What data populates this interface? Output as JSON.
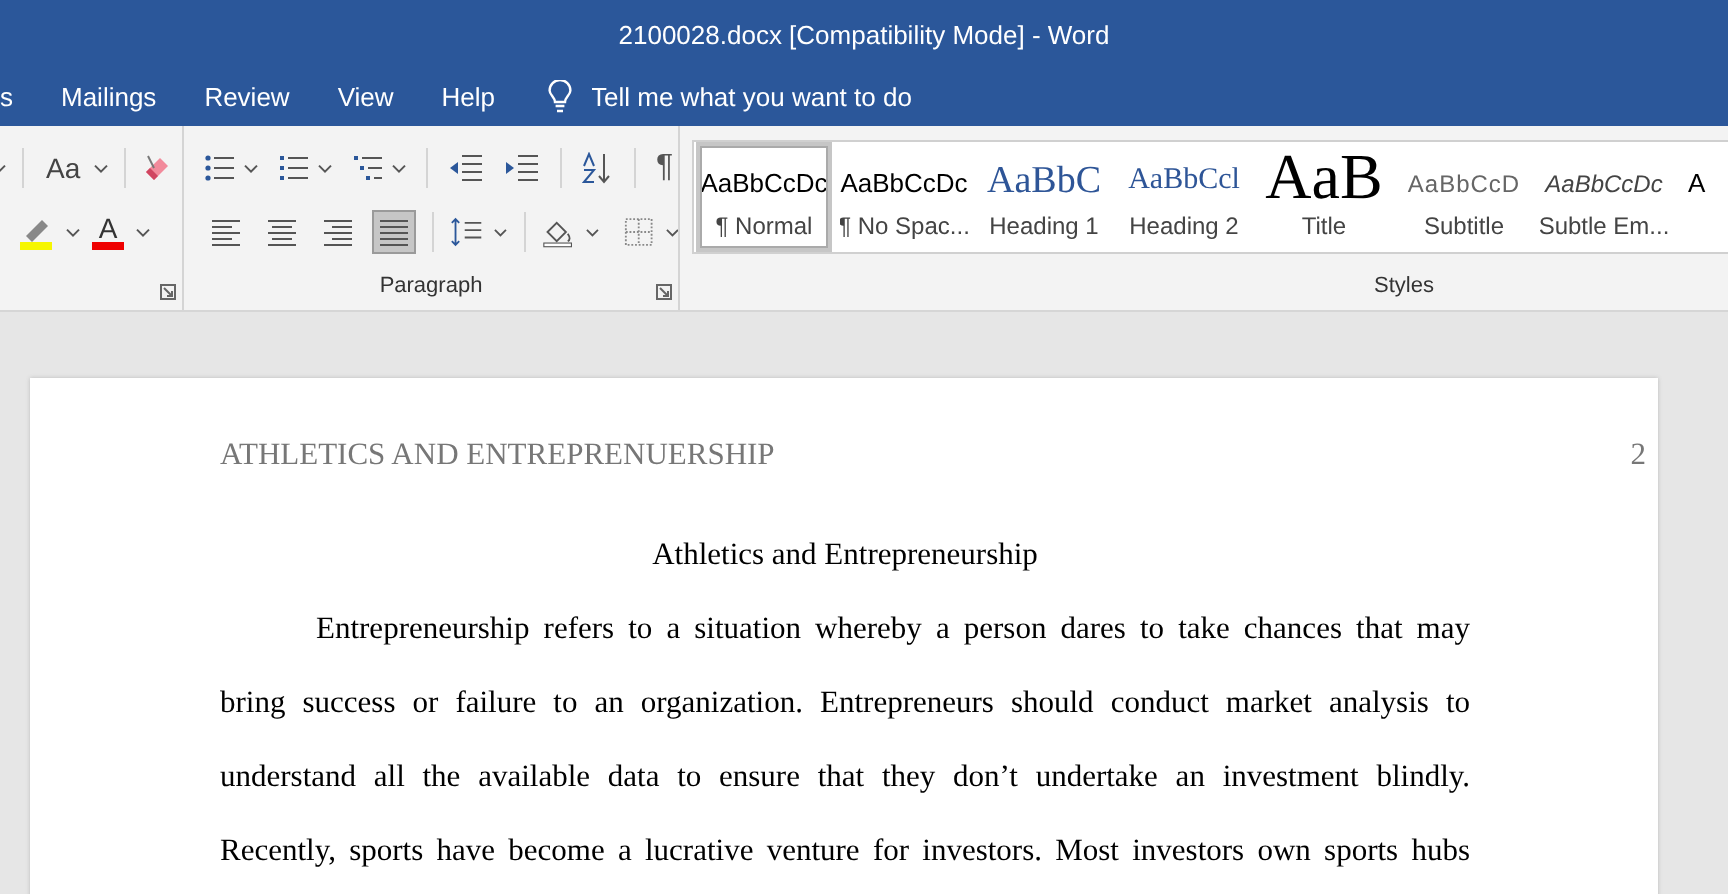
{
  "window": {
    "title": "2100028.docx [Compatibility Mode]  -  Word"
  },
  "tabs": [
    {
      "label": "s",
      "selected": false
    },
    {
      "label": "Mailings",
      "selected": false
    },
    {
      "label": "Review",
      "selected": false
    },
    {
      "label": "View",
      "selected": false
    },
    {
      "label": "Help",
      "selected": false
    }
  ],
  "tell_me": {
    "placeholder": "Tell me what you want to do"
  },
  "font_group": {
    "change_case": "Aa",
    "font_color_glyph": "A"
  },
  "paragraph_group": {
    "label": "Paragraph",
    "pilcrow": "¶",
    "alignments": [
      {
        "kind": "left",
        "selected": false
      },
      {
        "kind": "center",
        "selected": false
      },
      {
        "kind": "right",
        "selected": false
      },
      {
        "kind": "justify",
        "selected": true
      }
    ]
  },
  "styles_group": {
    "label": "Styles",
    "items": [
      {
        "kind": "normal",
        "preview": "AaBbCcDc",
        "label": "¶ Normal",
        "selected": true
      },
      {
        "kind": "normal",
        "preview": "AaBbCcDc",
        "label": "¶ No Spac...",
        "selected": false
      },
      {
        "kind": "heading1",
        "preview": "AaBbC",
        "label": "Heading 1",
        "selected": false
      },
      {
        "kind": "heading2",
        "preview": "AaBbCcl",
        "label": "Heading 2",
        "selected": false
      },
      {
        "kind": "title",
        "preview": "AaB",
        "label": "Title",
        "selected": false
      },
      {
        "kind": "subtitle",
        "preview": "AaBbCcD",
        "label": "Subtitle",
        "selected": false
      },
      {
        "kind": "emphasis",
        "preview": "AaBbCcDc",
        "label": "Subtle Em...",
        "selected": false
      },
      {
        "kind": "normal",
        "preview": "A",
        "selected": false
      }
    ]
  },
  "document": {
    "running_head": "ATHLETICS AND ENTREPRENUERSHIP",
    "page_number": "2",
    "title": "Athletics and Entrepreneurship",
    "paragraph_lines": [
      "Entrepreneurship refers to a situation whereby a person dares to take chances that may",
      "bring success or failure to an organization. Entrepreneurs should conduct market analysis to",
      "understand all the available data to ensure that they don’t undertake an investment blindly.",
      "Recently, sports have become a lucrative venture for investors. Most investors own sports hubs"
    ]
  }
}
